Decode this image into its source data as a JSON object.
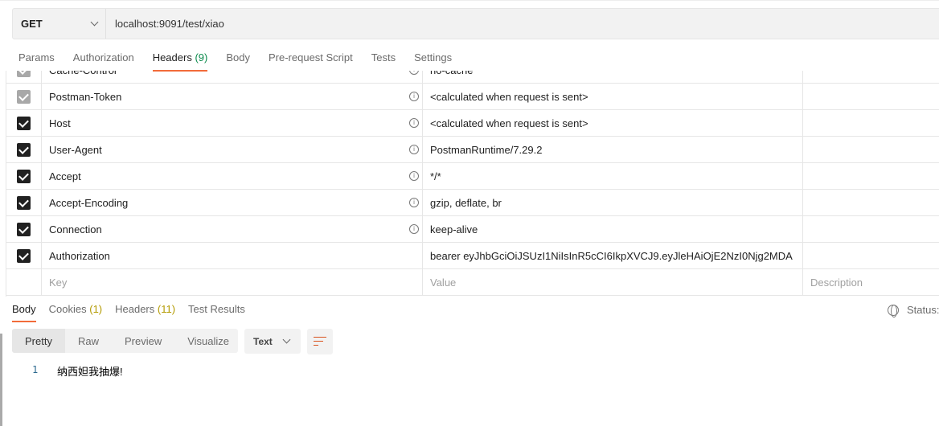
{
  "request": {
    "method": "GET",
    "url": "localhost:9091/test/xiao"
  },
  "tabs": [
    {
      "label": "Params"
    },
    {
      "label": "Authorization"
    },
    {
      "label": "Headers",
      "count": "(9)"
    },
    {
      "label": "Body"
    },
    {
      "label": "Pre-request Script"
    },
    {
      "label": "Tests"
    },
    {
      "label": "Settings"
    }
  ],
  "headers": [
    {
      "key": "Cache-Control",
      "value": "no-cache",
      "checked": true,
      "disabled": true
    },
    {
      "key": "Postman-Token",
      "value": "<calculated when request is sent>",
      "checked": true,
      "disabled": true
    },
    {
      "key": "Host",
      "value": "<calculated when request is sent>",
      "checked": true
    },
    {
      "key": "User-Agent",
      "value": "PostmanRuntime/7.29.2",
      "checked": true
    },
    {
      "key": "Accept",
      "value": "*/*",
      "checked": true
    },
    {
      "key": "Accept-Encoding",
      "value": "gzip, deflate, br",
      "checked": true
    },
    {
      "key": "Connection",
      "value": "keep-alive",
      "checked": true
    },
    {
      "key": "Authorization",
      "value": "bearer eyJhbGciOiJSUzI1NiIsInR5cCI6IkpXVCJ9.eyJleHAiOjE2NzI0Njg2MDA",
      "checked": true
    }
  ],
  "placeholders": {
    "key": "Key",
    "value": "Value",
    "description": "Description"
  },
  "response": {
    "tabs": [
      {
        "label": "Body"
      },
      {
        "label": "Cookies",
        "count": "(1)"
      },
      {
        "label": "Headers",
        "count": "(11)"
      },
      {
        "label": "Test Results"
      }
    ],
    "status_label": "Status:",
    "views": [
      "Pretty",
      "Raw",
      "Preview",
      "Visualize"
    ],
    "format": "Text",
    "line_number": "1",
    "body": "纳西妲我抽爆!"
  },
  "colors": {
    "accent": "#f26b3a",
    "count_green": "#0a8a4b"
  }
}
